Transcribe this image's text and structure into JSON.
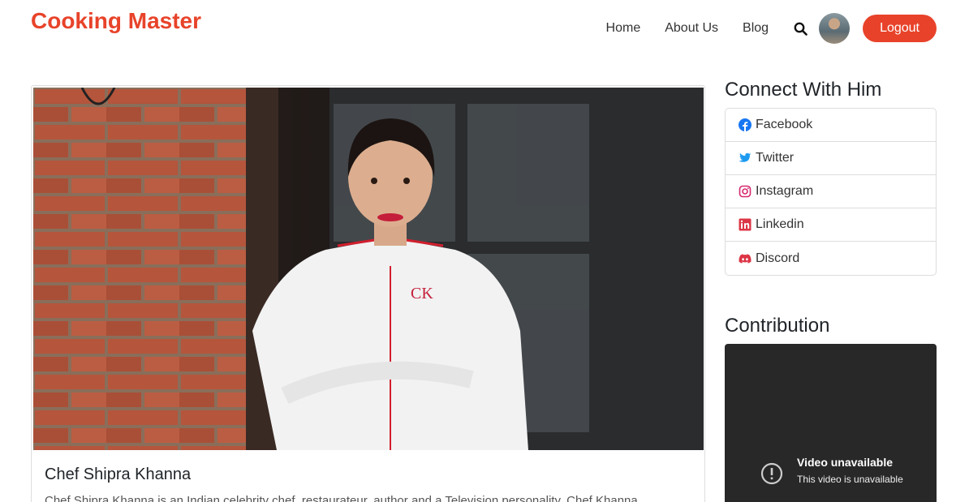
{
  "brand": "Cooking Master",
  "nav": {
    "home": "Home",
    "about": "About Us",
    "blog": "Blog",
    "logout": "Logout"
  },
  "card": {
    "title": "Chef Shipra Khanna",
    "text": "Chef Shipra Khanna is an Indian celebrity chef, restaurateur, author and a Television personality. Chef Khanna"
  },
  "connect": {
    "heading": "Connect With Him",
    "links": [
      {
        "label": "Facebook",
        "icon": "facebook-icon",
        "color": "#1877f2"
      },
      {
        "label": "Twitter",
        "icon": "twitter-icon",
        "color": "#1d9bf0"
      },
      {
        "label": "Instagram",
        "icon": "instagram-icon",
        "color": "#d6296e"
      },
      {
        "label": "Linkedin",
        "icon": "linkedin-icon",
        "color": "#dc3545"
      },
      {
        "label": "Discord",
        "icon": "discord-icon",
        "color": "#dc3545"
      }
    ]
  },
  "contribution": {
    "heading": "Contribution",
    "video_title": "Video unavailable",
    "video_sub": "This video is unavailable"
  },
  "colors": {
    "accent": "#e8432a"
  }
}
